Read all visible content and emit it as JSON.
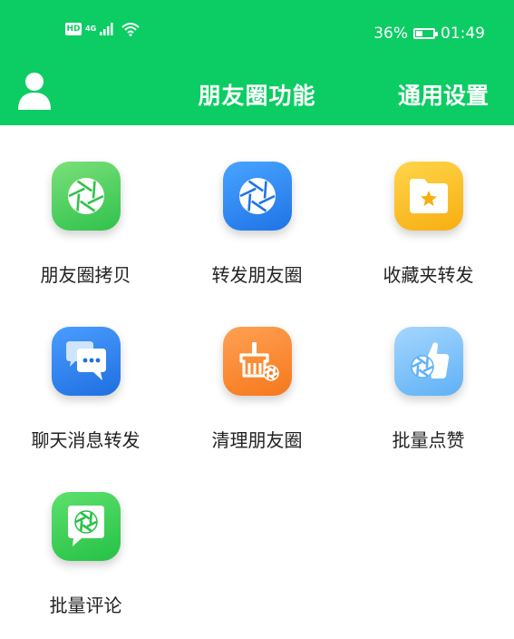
{
  "status_bar": {
    "hd": "HD",
    "network": "4G",
    "battery_percent": "36%",
    "battery_level": 0.36,
    "time": "01:49"
  },
  "nav": {
    "title": "朋友圈功能",
    "settings": "通用设置",
    "profile_icon": "person-icon"
  },
  "colors": {
    "header": "#0ccd63"
  },
  "features": [
    {
      "label": "朋友圈拷贝",
      "icon": "aperture-icon",
      "color_from": "#7be07a",
      "color_to": "#2fc24c"
    },
    {
      "label": "转发朋友圈",
      "icon": "aperture-icon",
      "color_from": "#48a4ff",
      "color_to": "#1f74e6"
    },
    {
      "label": "收藏夹转发",
      "icon": "folder-star-icon",
      "color_from": "#ffd54a",
      "color_to": "#f7ae11"
    },
    {
      "label": "聊天消息转发",
      "icon": "chat-bubbles-icon",
      "color_from": "#4a9dff",
      "color_to": "#1f6fe0"
    },
    {
      "label": "清理朋友圈",
      "icon": "broom-icon",
      "color_from": "#ffa153",
      "color_to": "#f6781c"
    },
    {
      "label": "批量点赞",
      "icon": "thumbs-up-icon",
      "color_from": "#a5d6ff",
      "color_to": "#5fb1f5"
    },
    {
      "label": "批量评论",
      "icon": "comment-aperture-icon",
      "color_from": "#5ee06d",
      "color_to": "#25c146"
    }
  ]
}
